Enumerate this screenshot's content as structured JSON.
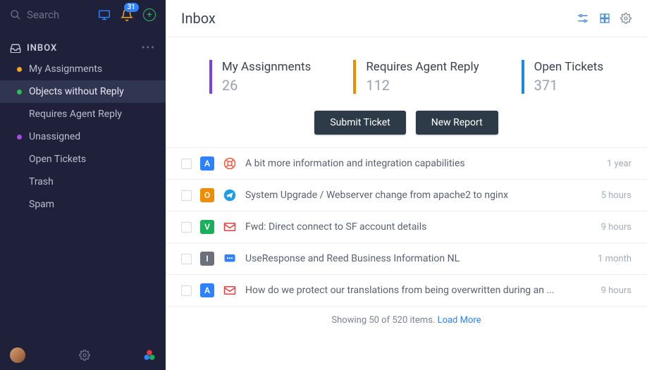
{
  "sidebar": {
    "search_placeholder": "Search",
    "notification_count": "31",
    "section_title": "INBOX",
    "items": [
      {
        "label": "My Assignments",
        "bullet": "#f5a623"
      },
      {
        "label": "Objects without Reply",
        "bullet": "#2abf5b",
        "selected": true
      },
      {
        "label": "Requires Agent Reply",
        "bullet": ""
      },
      {
        "label": "Unassigned",
        "bullet": "#a24fe0"
      },
      {
        "label": "Open Tickets",
        "bullet": ""
      },
      {
        "label": "Trash",
        "bullet": ""
      },
      {
        "label": "Spam",
        "bullet": ""
      }
    ]
  },
  "header": {
    "title": "Inbox"
  },
  "stats": [
    {
      "label": "My Assignments",
      "value": "26",
      "color": "#7b3fe4"
    },
    {
      "label": "Requires Agent Reply",
      "value": "112",
      "color": "#f08c00"
    },
    {
      "label": "Open Tickets",
      "value": "371",
      "color": "#1e88e5"
    }
  ],
  "actions": {
    "submit": "Submit Ticket",
    "report": "New Report"
  },
  "tickets": [
    {
      "tag": "A",
      "tag_color": "#2f82ff",
      "icon": "lifebuoy",
      "icon_color": "#f05a3c",
      "subject": "A bit more information and integration capabilities",
      "time": "1 year"
    },
    {
      "tag": "O",
      "tag_color": "#f08c00",
      "icon": "telegram",
      "icon_color": "#1e9ee5",
      "subject": "System Upgrade / Webserver change from apache2 to nginx",
      "time": "5 hours"
    },
    {
      "tag": "V",
      "tag_color": "#1aaf5d",
      "icon": "mail",
      "icon_color": "#e23c3c",
      "subject": "Fwd: Direct connect to SF account details",
      "time": "9 hours"
    },
    {
      "tag": "I",
      "tag_color": "#6c707a",
      "icon": "chat",
      "icon_color": "#2f82ff",
      "subject": "UseResponse and Reed Business Information NL",
      "time": "1 month"
    },
    {
      "tag": "A",
      "tag_color": "#2f82ff",
      "icon": "mail",
      "icon_color": "#e23c3c",
      "subject": "How do we protect our translations from being overwritten during an ...",
      "time": "9 hours"
    }
  ],
  "footer": {
    "text": "Showing 50 of 520 items. ",
    "link": "Load More"
  }
}
